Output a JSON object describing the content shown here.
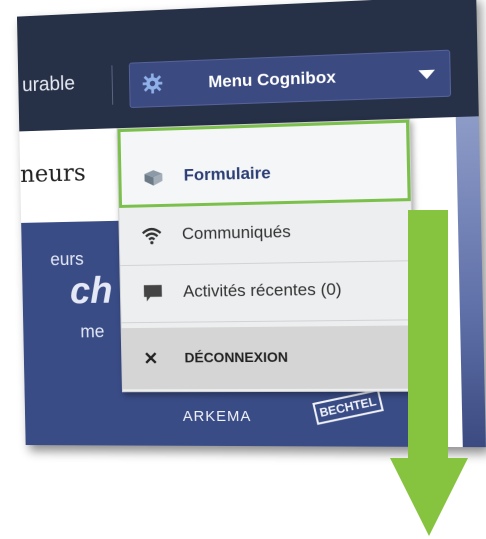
{
  "header": {
    "brand_text": "urable",
    "menu_button_label": "Menu Cognibox"
  },
  "page": {
    "heading_fragment": "neurs",
    "banner_line1": "eurs",
    "banner_line2": "ch",
    "banner_line3": "me",
    "logo_arkema": "ARKEMA",
    "logo_bechtel": "BECHTEL"
  },
  "dropdown": {
    "items": [
      {
        "label": "Formulaire",
        "icon": "box-icon"
      },
      {
        "label": "Communiqués",
        "icon": "wifi-icon"
      },
      {
        "label": "Activités récentes (0)",
        "icon": "chat-icon"
      },
      {
        "label": "DÉCONNEXION",
        "icon": "x-icon"
      }
    ]
  },
  "colors": {
    "topbar": "#263046",
    "menu_button": "#3b4a80",
    "highlight_border": "#7cc04c",
    "arrow": "#86c440"
  }
}
